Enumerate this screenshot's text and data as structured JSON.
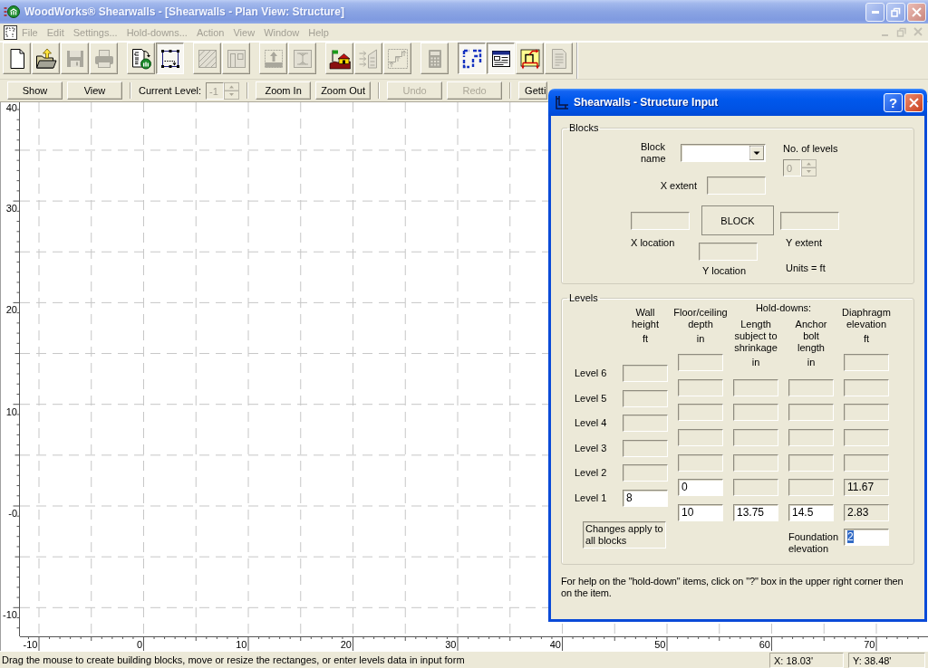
{
  "window": {
    "title": "WoodWorks® Shearwalls - [Shearwalls - Plan View: Structure]"
  },
  "menu": [
    {
      "label": "File",
      "disabled": true
    },
    {
      "label": "Edit",
      "disabled": true
    },
    {
      "label": "Settings...",
      "disabled": true
    },
    {
      "label": "Hold-downs...",
      "disabled": true
    },
    {
      "label": "Action",
      "disabled": true
    },
    {
      "label": "View",
      "disabled": true
    },
    {
      "label": "Window",
      "disabled": true
    },
    {
      "label": "Help",
      "disabled": true
    }
  ],
  "toolbar_groups": [
    {
      "buttons": [
        {
          "kind": "new",
          "disabled": false,
          "pressed": false
        },
        {
          "kind": "open",
          "disabled": false,
          "pressed": false
        },
        {
          "kind": "save",
          "disabled": true,
          "pressed": false
        },
        {
          "kind": "print",
          "disabled": true,
          "pressed": false
        }
      ]
    },
    {
      "buttons": [
        {
          "kind": "import",
          "disabled": false,
          "pressed": false
        },
        {
          "kind": "select",
          "disabled": false,
          "pressed": true
        }
      ]
    },
    {
      "buttons": [
        {
          "kind": "walls",
          "disabled": true,
          "pressed": false
        },
        {
          "kind": "openings",
          "disabled": true,
          "pressed": false
        }
      ]
    },
    {
      "buttons": [
        {
          "kind": "raise",
          "disabled": true,
          "pressed": false
        },
        {
          "kind": "section",
          "disabled": true,
          "pressed": false
        }
      ]
    },
    {
      "buttons": [
        {
          "kind": "site",
          "disabled": false,
          "pressed": false
        },
        {
          "kind": "loads",
          "disabled": true,
          "pressed": false
        },
        {
          "kind": "distribute",
          "disabled": true,
          "pressed": false
        }
      ]
    },
    {
      "buttons": [
        {
          "kind": "calculator",
          "disabled": true,
          "pressed": false
        }
      ]
    },
    {
      "buttons": [
        {
          "kind": "plan",
          "disabled": false,
          "pressed": true
        },
        {
          "kind": "form",
          "disabled": false,
          "pressed": true
        },
        {
          "kind": "design",
          "disabled": false,
          "pressed": false
        },
        {
          "kind": "report",
          "disabled": true,
          "pressed": false
        }
      ]
    }
  ],
  "command_bar": [
    {
      "kind": "button",
      "label": "Show",
      "disabled": false
    },
    {
      "kind": "button",
      "label": "View",
      "disabled": false
    },
    {
      "kind": "separator"
    },
    {
      "kind": "label",
      "label": "Current Level:"
    },
    {
      "kind": "spinner",
      "value": "-1",
      "disabled": true
    },
    {
      "kind": "separator"
    },
    {
      "kind": "button",
      "label": "Zoom In",
      "disabled": false
    },
    {
      "kind": "button",
      "label": "Zoom Out",
      "disabled": false
    },
    {
      "kind": "separator"
    },
    {
      "kind": "button",
      "label": "Undo",
      "disabled": true
    },
    {
      "kind": "button",
      "label": "Redo",
      "disabled": true
    },
    {
      "kind": "separator"
    },
    {
      "kind": "button",
      "label": "Getti",
      "disabled": false
    }
  ],
  "plan_view": {
    "y_ruler": [
      "40",
      "30",
      "20",
      "10",
      "-0",
      "-10"
    ],
    "x_ruler": [
      "-10",
      "0",
      "10",
      "20",
      "30",
      "40",
      "50",
      "60",
      "70"
    ]
  },
  "status_bar": {
    "message": "Drag the mouse to create building blocks, move or resize the rectanges, or enter levels data in input form",
    "x_position": "X: 18.03'",
    "y_position": "Y: 38.48'"
  },
  "dialog": {
    "title": "Shearwalls - Structure Input",
    "help_button": "?",
    "blocks": {
      "title": "Blocks",
      "block_name": {
        "label": "Block name"
      },
      "number_of_levels": {
        "label": "No. of levels",
        "value": "0",
        "disabled": true
      },
      "x_extent": {
        "label": "X extent",
        "disabled": true
      },
      "x_location": {
        "label": "X location",
        "disabled": true
      },
      "block_button": "BLOCK",
      "y_extent": {
        "label": "Y extent",
        "disabled": true
      },
      "y_location": {
        "label": "Y location",
        "disabled": true
      },
      "units": "Units = ft"
    },
    "levels": {
      "title": "Levels",
      "hold_downs_heading": "Hold-downs:",
      "columns": [
        {
          "heading": "Wall height",
          "unit": "ft"
        },
        {
          "heading": "Floor/ceiling depth",
          "unit": "in"
        },
        {
          "heading": "Length subject to shrinkage",
          "unit": "in"
        },
        {
          "heading": "Anchor bolt length",
          "unit": "in"
        },
        {
          "heading": "Diaphragm elevation",
          "unit": "ft"
        }
      ],
      "rows": [
        {
          "label": "Level 6",
          "wall_height": {
            "disabled": true
          }
        },
        {
          "label": "Level 5",
          "wall_height": {
            "disabled": true
          }
        },
        {
          "label": "Level 4",
          "wall_height": {
            "disabled": true
          }
        },
        {
          "label": "Level 3",
          "wall_height": {
            "disabled": true
          }
        },
        {
          "label": "Level 2",
          "wall_height": {
            "disabled": true
          }
        },
        {
          "label": "Level 1",
          "wall_height": {
            "value": "8",
            "disabled": false
          }
        }
      ],
      "interfaces": [
        {
          "floor_depth": {
            "disabled": true
          },
          "diaphragm": {
            "disabled": true
          }
        },
        {
          "floor_depth": {
            "disabled": true
          },
          "length": {
            "disabled": true
          },
          "anchor": {
            "disabled": true
          },
          "diaphragm": {
            "disabled": true
          }
        },
        {
          "floor_depth": {
            "disabled": true
          },
          "length": {
            "disabled": true
          },
          "anchor": {
            "disabled": true
          },
          "diaphragm": {
            "disabled": true
          }
        },
        {
          "floor_depth": {
            "disabled": true
          },
          "length": {
            "disabled": true
          },
          "anchor": {
            "disabled": true
          },
          "diaphragm": {
            "disabled": true
          }
        },
        {
          "floor_depth": {
            "disabled": true
          },
          "length": {
            "disabled": true
          },
          "anchor": {
            "disabled": true
          },
          "diaphragm": {
            "disabled": true
          }
        },
        {
          "floor_depth": {
            "value": "0",
            "disabled": false
          },
          "length": {
            "disabled": true
          },
          "anchor": {
            "disabled": true
          },
          "diaphragm": {
            "value": "11.67",
            "disabled": true
          }
        },
        {
          "floor_depth": {
            "value": "10",
            "disabled": false
          },
          "length": {
            "value": "13.75",
            "disabled": false
          },
          "anchor": {
            "value": "14.5",
            "disabled": false
          },
          "diaphragm": {
            "value": "2.83",
            "disabled": true
          }
        }
      ],
      "note": "Changes apply to all blocks",
      "foundation": {
        "label": "Foundation elevation",
        "value": "2",
        "disabled": false,
        "text_highlighted": true
      }
    },
    "help_text": "For help on the \"hold-down\" items, click on \"?\" box in the upper right corner then on the item."
  }
}
